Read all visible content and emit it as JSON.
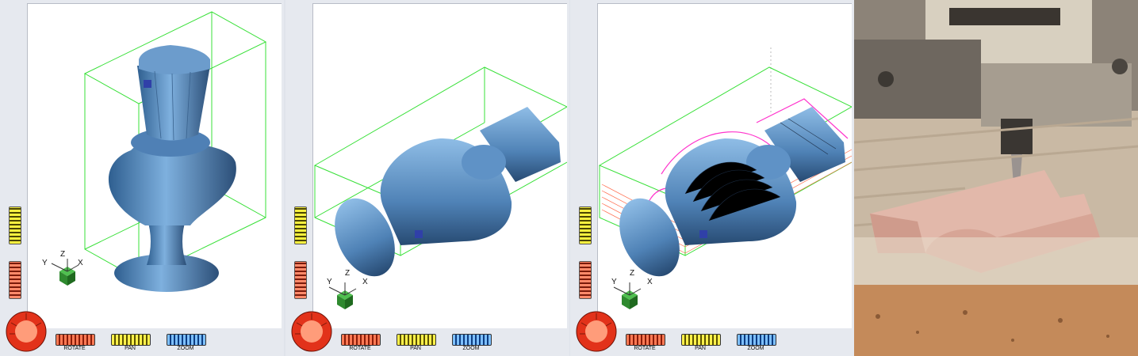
{
  "panels": [
    {
      "controls": {
        "rotate": "ROTATE",
        "pan": "PAN",
        "zoom": "ZOOM"
      },
      "axes": {
        "x": "X",
        "y": "Y",
        "z": "Z"
      }
    },
    {
      "controls": {
        "rotate": "ROTATE",
        "pan": "PAN",
        "zoom": "ZOOM"
      },
      "axes": {
        "x": "X",
        "y": "Y",
        "z": "Z"
      }
    },
    {
      "controls": {
        "rotate": "ROTATE",
        "pan": "PAN",
        "zoom": "ZOOM"
      },
      "axes": {
        "x": "X",
        "y": "Y",
        "z": "Z"
      }
    }
  ],
  "colors": {
    "model": "#5b8fc4",
    "bounding_box": "#38e038",
    "toolpath_pink": "#ff33cc",
    "toolpath_orange": "#ff6a4a",
    "axis_cube": "#2f9a2f"
  },
  "photo": {
    "subject": "cnc-milling-machine-photo"
  }
}
